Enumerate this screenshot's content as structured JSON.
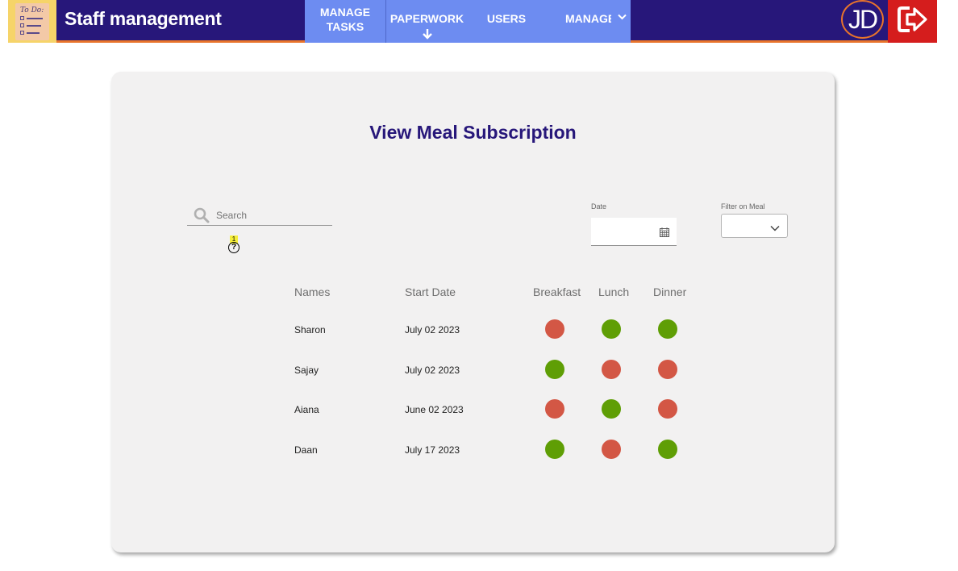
{
  "header": {
    "brand": "Staff management",
    "logo_text": "To Do:",
    "nav": {
      "manage_tasks_line1": "MANAGE",
      "manage_tasks_line2": "TASKS",
      "paperwork": "PAPERWORK",
      "users": "USERS",
      "manage_more": "MANAGE"
    },
    "avatar_initials": "JD",
    "colors": {
      "bar": "#27177a",
      "nav": "#6d8cf1",
      "accent": "#e8742b",
      "logout": "#d51d1d"
    }
  },
  "main": {
    "title": "View Meal Subscription",
    "search_placeholder": "Search",
    "help_badge": "1",
    "help_icon": "?",
    "date_label": "Date",
    "meal_filter_label": "Filter on Meal",
    "columns": [
      "Names",
      "Start Date",
      "Breakfast",
      "Lunch",
      "Dinner"
    ],
    "rows": [
      {
        "name": "Sharon",
        "start_date": "July 02 2023",
        "breakfast": false,
        "lunch": true,
        "dinner": true
      },
      {
        "name": "Sajay",
        "start_date": "July 02 2023",
        "breakfast": true,
        "lunch": false,
        "dinner": false
      },
      {
        "name": "Aiana",
        "start_date": "June 02 2023",
        "breakfast": false,
        "lunch": true,
        "dinner": false
      },
      {
        "name": "Daan",
        "start_date": "July 17 2023",
        "breakfast": true,
        "lunch": false,
        "dinner": true
      }
    ],
    "status_colors": {
      "subscribed": "#5f9e05",
      "not_subscribed": "#d35745"
    }
  },
  "icons": [
    "todo-note-icon",
    "arrow-down-icon",
    "chevron-down-icon",
    "logout-icon",
    "search-icon",
    "help-icon",
    "calendar-icon"
  ]
}
